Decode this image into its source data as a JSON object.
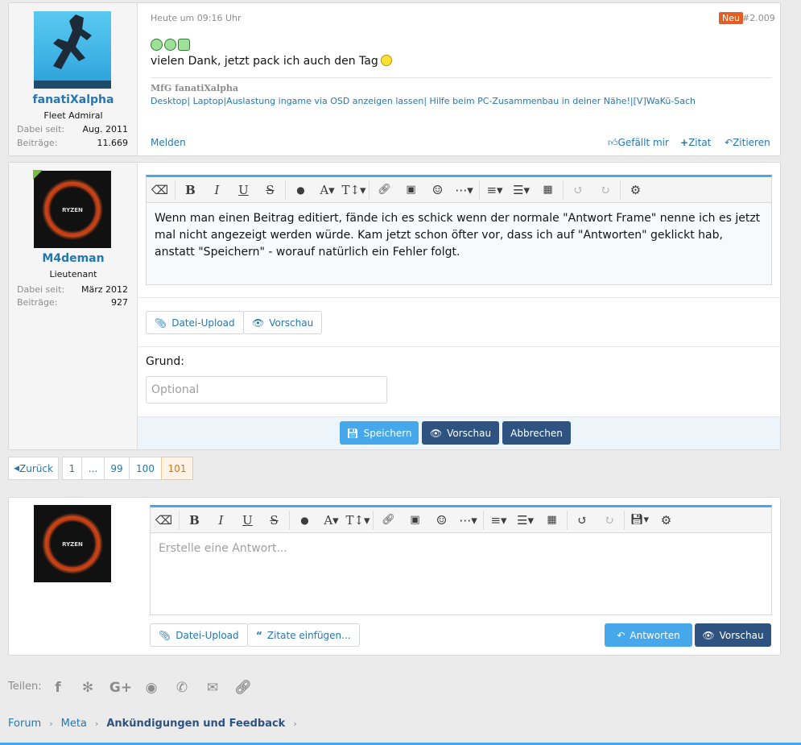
{
  "post1": {
    "username": "fanatiXalpha",
    "usertitle": "Fleet Admiral",
    "joined_label": "Dabei seit:",
    "joined_value": "Aug. 2011",
    "posts_label": "Beiträge:",
    "posts_value": "11.669",
    "date": "Heute um 09:16 Uhr",
    "badge": "Neu",
    "post_number": "#2.009",
    "text": "vielen Dank, jetzt pack ich auch den Tag",
    "sig_title": "MfG fanatiXalpha",
    "sig_links": [
      "Desktop",
      "| Laptop",
      "|Auslastung ingame via OSD anzeigen lassen",
      "| Hilfe beim PC-Zusammenbau in deiner Nähe!",
      "|[V]WaKü-Sach"
    ],
    "report": "Melden",
    "like": "Gefällt mir",
    "quote": "Zitat",
    "reply": "Zitieren"
  },
  "post2": {
    "username": "M4deman",
    "usertitle": "Lieutenant",
    "joined_label": "Dabei seit:",
    "joined_value": "März 2012",
    "posts_label": "Beiträge:",
    "posts_value": "927",
    "avatar_text": "RYZEN",
    "editor_text": "Wenn man einen Beitrag editiert, fände ich es schick wenn der normale \"Antwort Frame\" nenne ich es jetzt mal nicht angezeigt werden würde. Kam jetzt schon öfter vor, dass ich auf \"Antworten\" geklickt hab, anstatt \"Speichern\" - worauf natürlich ein Fehler folgt.",
    "upload": "Datei-Upload",
    "preview": "Vorschau",
    "reason_label": "Grund:",
    "reason_placeholder": "Optional",
    "save": "Speichern",
    "preview2": "Vorschau",
    "cancel": "Abbrechen"
  },
  "pagination": {
    "back": "Zurück",
    "pages": [
      "1",
      "...",
      "99",
      "100",
      "101"
    ],
    "current": "101"
  },
  "reply_box": {
    "avatar_text": "RYZEN",
    "placeholder": "Erstelle eine Antwort...",
    "upload": "Datei-Upload",
    "insert_quotes": "Zitate einfügen...",
    "reply": "Antworten",
    "preview": "Vorschau"
  },
  "share": {
    "label": "Teilen:",
    "icons": [
      "facebook-icon",
      "twitter-icon",
      "google-plus-icon",
      "reddit-icon",
      "whatsapp-icon",
      "email-icon",
      "link-icon"
    ]
  },
  "breadcrumb": [
    "Forum",
    "Meta",
    "Ankündigungen und Feedback"
  ],
  "colors": {
    "accent": "#47a7eb",
    "link": "#2577b1",
    "dark_button": "#2f5380",
    "badge_new": "#e25e24"
  }
}
